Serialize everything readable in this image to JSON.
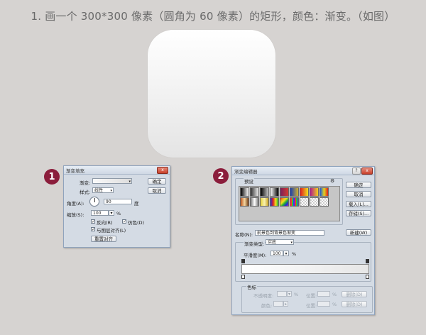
{
  "title": "1. 画一个 300*300 像素（圆角为 60 像素）的矩形，颜色：渐变。（如图）",
  "badges": [
    "1",
    "2"
  ],
  "gradient_fill_dialog": {
    "title": "渐变填充",
    "close_label": "x",
    "gradient_label": "渐变:",
    "ok_label": "确定",
    "cancel_label": "取消",
    "style_label": "样式:",
    "style_value": "线性",
    "angle_label": "角度(A):",
    "angle_value": "90",
    "angle_unit": "度",
    "scale_label": "缩放(S):",
    "scale_value": "100",
    "scale_unit": "%",
    "reverse_label": "反向(R)",
    "dither_label": "仿色(D)",
    "align_label": "与图层对齐(L)",
    "reset_label": "重置对齐"
  },
  "gradient_editor_dialog": {
    "title": "渐变编辑器",
    "help_label": "?",
    "close_label": "x",
    "presets_label": "预设",
    "gear_glyph": "⚙",
    "ok_label": "确定",
    "cancel_label": "取消",
    "load_label": "载入(L)...",
    "save_label": "存储(S)...",
    "name_label": "名称(N):",
    "name_value": "前景色到背景色渐变",
    "new_label": "新建(W)",
    "type_label": "渐变类型:",
    "type_value": "实底",
    "smooth_label": "平滑度(M):",
    "smooth_value": "100",
    "smooth_unit": "%",
    "stops_label": "色标",
    "opacity_label": "不透明度:",
    "color_label": "颜色:",
    "location_label": "位置:",
    "percent": "%",
    "delete_label": "删除(D)"
  },
  "colors": {
    "badge": "#8b1d3b",
    "background": "#d6d3d1",
    "dialog": "#d4dbe4"
  },
  "icons": [
    "close-icon",
    "help-icon",
    "gear-icon",
    "dropdown-arrow-icon",
    "angle-dial-icon",
    "checkbox-check-icon",
    "color-stop-icon"
  ]
}
